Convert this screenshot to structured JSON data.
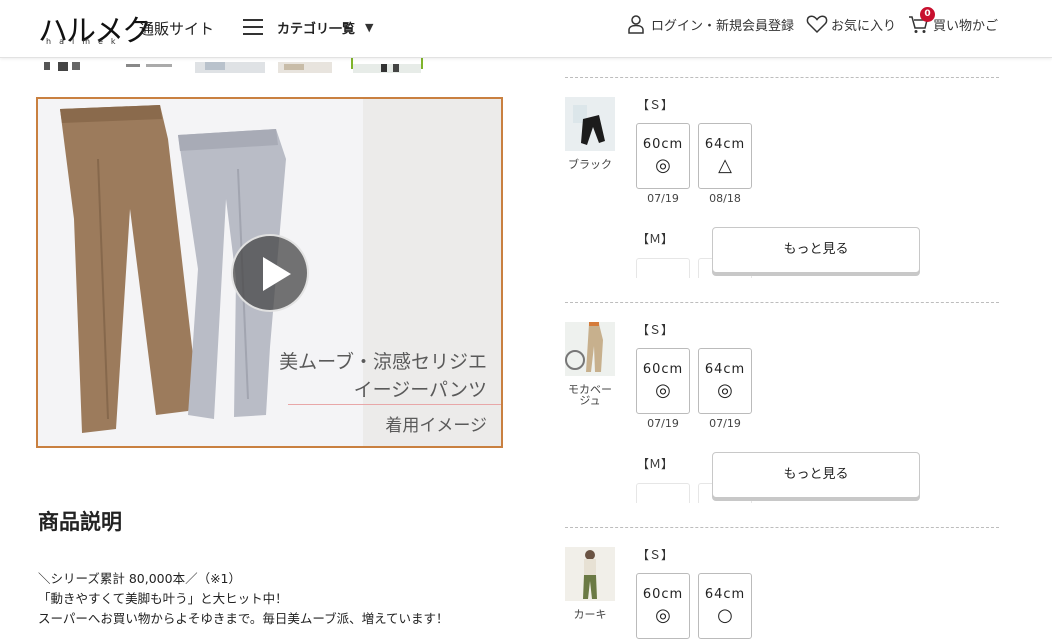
{
  "header": {
    "logo_main": "ハルメク",
    "logo_sub": "通販サイト",
    "logo_roman": "halmek",
    "category_label": "カテゴリ一覧",
    "login_label": "ログイン・新規会員登録",
    "favorites_label": "お気に入り",
    "cart_label": "買い物かご",
    "cart_count": "0",
    "accent_color": "#c8102e"
  },
  "video": {
    "title_line1": "美ムーブ・涼感セリジエ",
    "title_line2": "イージーパンツ",
    "subtitle": "着用イメージ",
    "border_color": "#c98040"
  },
  "description": {
    "heading": "商品説明",
    "line1": "＼シリーズ累計 80,000本／（※1）",
    "line2": "「動きやすくて美脚も叶う」と大ヒット中！",
    "line3": "スーパーへお買い物からよそゆきまで。毎日美ムーブ派、増えています！"
  },
  "colors": [
    {
      "name": "ブラック",
      "size_s_label": "【Ｓ】",
      "size_m_label": "【Ｍ】",
      "options": [
        {
          "length": "60cm",
          "stock": "◎",
          "date": "07/19"
        },
        {
          "length": "64cm",
          "stock": "△",
          "date": "08/18"
        }
      ],
      "more_label": "もっと見る"
    },
    {
      "name": "モカベージュ",
      "size_s_label": "【Ｓ】",
      "size_m_label": "【Ｍ】",
      "options": [
        {
          "length": "60cm",
          "stock": "◎",
          "date": "07/19"
        },
        {
          "length": "64cm",
          "stock": "◎",
          "date": "07/19"
        }
      ],
      "more_label": "もっと見る"
    },
    {
      "name": "カーキ",
      "size_s_label": "【Ｓ】",
      "options": [
        {
          "length": "60cm",
          "stock": "◎"
        },
        {
          "length": "64cm",
          "stock": "○"
        }
      ]
    }
  ]
}
